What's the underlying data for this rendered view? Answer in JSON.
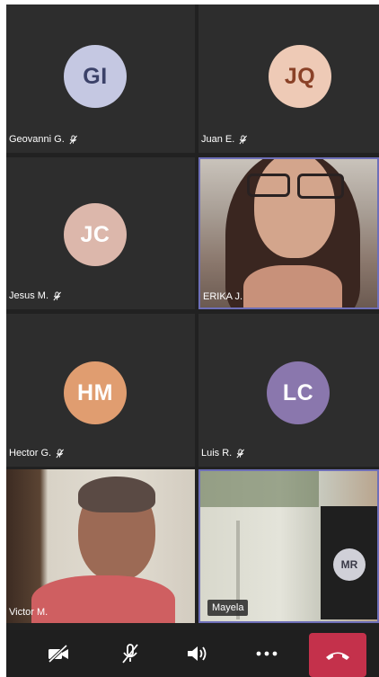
{
  "participants": [
    {
      "initials": "GI",
      "name": "Geovanni G.",
      "avatar_bg": "#c5c8e2",
      "avatar_fg": "#3b4168",
      "muted": true
    },
    {
      "initials": "JQ",
      "name": "Juan E.",
      "avatar_bg": "#eecab6",
      "avatar_fg": "#8a4127",
      "muted": true
    },
    {
      "initials": "JC",
      "name": "Jesus M.",
      "avatar_bg": "#dcb7ab",
      "avatar_fg": "#ffffff",
      "muted": true
    },
    {
      "name": "ERIKA J.",
      "video": true,
      "active": true
    },
    {
      "initials": "HM",
      "name": "Hector G.",
      "avatar_bg": "#e09d70",
      "avatar_fg": "#ffffff",
      "muted": true
    },
    {
      "initials": "LC",
      "name": "Luis R.",
      "avatar_bg": "#8a77ad",
      "avatar_fg": "#ffffff",
      "muted": true
    },
    {
      "name": "Victor M.",
      "video": true
    },
    {
      "name": "Mayela",
      "video": true,
      "active": true
    }
  ],
  "self_view": {
    "initials": "MR"
  },
  "controls": {
    "camera_icon": "camera-off-icon",
    "mic_icon": "mic-off-icon",
    "speaker_icon": "speaker-icon",
    "more_icon": "more-icon",
    "hangup_icon": "hangup-icon",
    "hangup_color": "#c4314b"
  },
  "colors": {
    "background": "#212121",
    "tile": "#2d2d2d",
    "active_border": "#6e6fb8"
  }
}
